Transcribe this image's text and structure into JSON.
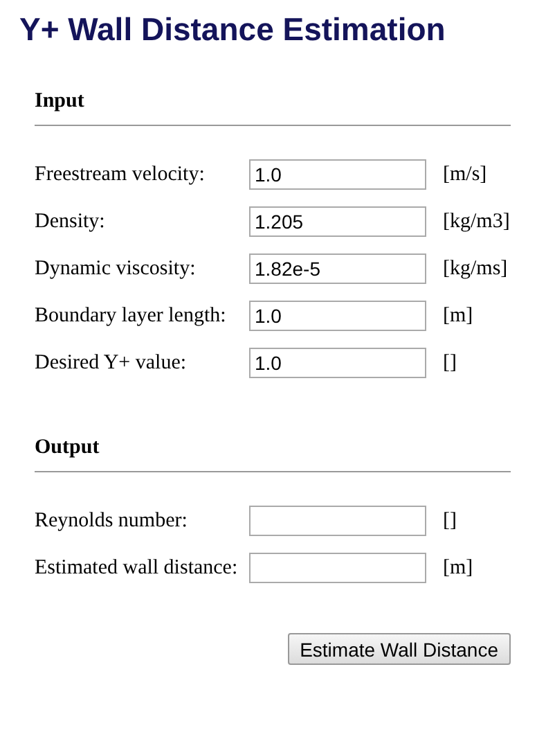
{
  "title": "Y+ Wall Distance Estimation",
  "sections": [
    {
      "heading": "Input",
      "rows": [
        {
          "label": "Freestream velocity:",
          "value": "1.0",
          "unit": "[m/s]"
        },
        {
          "label": "Density:",
          "value": "1.205",
          "unit": "[kg/m3]"
        },
        {
          "label": "Dynamic viscosity:",
          "value": "1.82e-5",
          "unit": "[kg/ms]"
        },
        {
          "label": "Boundary layer length:",
          "value": "1.0",
          "unit": "[m]"
        },
        {
          "label": "Desired Y+ value:",
          "value": "1.0",
          "unit": "[]"
        }
      ]
    },
    {
      "heading": "Output",
      "rows": [
        {
          "label": "Reynolds number:",
          "value": "",
          "unit": "[]"
        },
        {
          "label": "Estimated wall distance:",
          "value": "",
          "unit": "[m]"
        }
      ]
    }
  ],
  "button": "Estimate Wall Distance"
}
